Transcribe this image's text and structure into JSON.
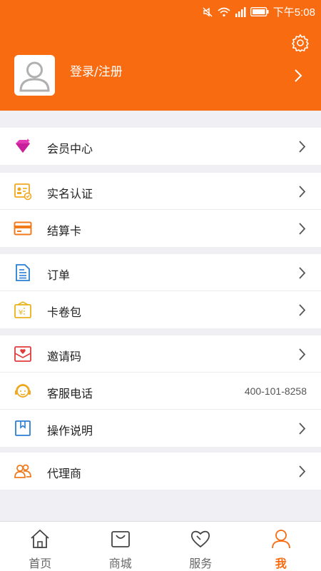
{
  "status_bar": {
    "time": "下午5:08"
  },
  "header": {
    "login_label": "登录/注册"
  },
  "menu": {
    "member_center": "会员中心",
    "real_name": "实名认证",
    "settlement_card": "结算卡",
    "orders": "订单",
    "coupon_wallet": "卡卷包",
    "invite_code": "邀请码",
    "customer_service": "客服电话",
    "customer_service_phone": "400-101-8258",
    "instructions": "操作说明",
    "agent": "代理商"
  },
  "tabbar": {
    "home": "首页",
    "mall": "商城",
    "service": "服务",
    "me": "我"
  },
  "colors": {
    "accent": "#f86b10",
    "background": "#efeff4"
  }
}
